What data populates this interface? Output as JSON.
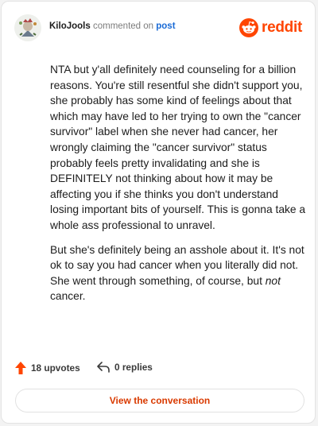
{
  "header": {
    "username": "KiloJools",
    "action_text": "commented on",
    "post_link": "post",
    "brand": "reddit"
  },
  "comment": {
    "para1": "NTA but y'all definitely need counseling for a billion reasons. You're still resentful she didn't support you, she probably has some kind of feelings about that which may have led to her trying to own the \"cancer survivor\" label when she never had cancer, her wrongly claiming the \"cancer survivor\" status probably feels pretty invalidating and she is DEFINITELY not thinking about how it may be affecting you if she thinks you don't understand losing important bits of yourself. This is gonna take a whole ass professional to unravel.",
    "para2_start": "But she's definitely being an asshole about it. It's not ok to say you had cancer when you literally did not. She went through something, of course, but ",
    "para2_emph": "not",
    "para2_end": " cancer."
  },
  "actions": {
    "upvotes": "18 upvotes",
    "replies": "0 replies"
  },
  "cta": {
    "label": "View the conversation"
  },
  "colors": {
    "brand": "#ff4500",
    "link": "#1a6bd6",
    "cta_text": "#d93a00"
  },
  "icons": [
    "avatar-image",
    "reddit-logo-icon",
    "upvote-arrow-icon",
    "reply-arrow-icon"
  ]
}
